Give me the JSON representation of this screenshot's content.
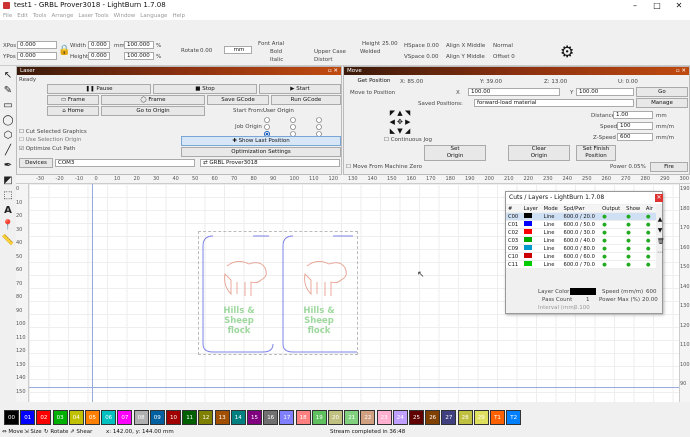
{
  "window": {
    "title": "test1 - GRBL Prover3018 - LightBurn 1.7.08"
  },
  "menu": [
    "File",
    "Edit",
    "Tools",
    "Arrange",
    "Laser Tools",
    "Window",
    "Language",
    "Help"
  ],
  "toolbar": {
    "icons": [
      "open-icon",
      "save-icon",
      "import-icon",
      "export-icon",
      "undo-icon",
      "redo-icon",
      "copy-icon",
      "paste-icon",
      "cut-icon",
      "delete-icon",
      "cursor-icon",
      "zoom-in-icon",
      "zoom-out-icon",
      "zoom-fit-icon",
      "pan-icon",
      "frame-icon",
      "camera-icon",
      "settings-icon",
      "wrench-icon",
      "monitor-icon",
      "window-icon",
      "clock-icon",
      "machine-icon",
      "gear-icon",
      "trace-icon"
    ]
  },
  "position": {
    "xpos_label": "XPos",
    "xpos": "0.000",
    "ypos_label": "YPos",
    "ypos": "0.000",
    "width_label": "Width",
    "width": "0.000",
    "height_label": "Height",
    "height": "0.000",
    "unit": "mm",
    "pct": "100.000",
    "pct_unit": "%",
    "rotate_label": "Rotate",
    "rotate": "0.00",
    "rot_unit": "mm"
  },
  "font": {
    "label": "Font",
    "value": "Arial",
    "height_label": "Height",
    "height": "25.00",
    "bold": "Bold",
    "italic": "Italic",
    "upper": "Upper Case",
    "welded": "Welded",
    "distort": "Distort",
    "hspace_label": "HSpace",
    "hspace": "0.00",
    "vspace_label": "VSpace",
    "vspace": "0.00",
    "alignx": "Align X Middle",
    "aligny": "Align Y Middle",
    "normal": "Normal",
    "offset_label": "Offset",
    "offset": "0"
  },
  "laser": {
    "title": "Laser",
    "status": "Ready",
    "pause": "Pause",
    "stop": "Stop",
    "start": "Start",
    "frame1": "Frame",
    "frame2": "Frame",
    "save_gcode": "Save GCode",
    "run_gcode": "Run GCode",
    "home": "Home",
    "goto_origin": "Go to Origin",
    "start_from_label": "Start From:",
    "start_from": "User Origin",
    "job_origin_label": "Job Origin",
    "cut_selected": "Cut Selected Graphics",
    "use_selection": "Use Selection Origin",
    "optimize": "Optimize Cut Path",
    "show_last": "Show Last Position",
    "opt_settings": "Optimization Settings",
    "devices": "Devices",
    "port": "COM3",
    "device": "GRBL Prover3018"
  },
  "move": {
    "title": "Move",
    "get_position": "Get Position",
    "x_label": "X:",
    "x": "85.00",
    "y_label": "Y:",
    "y": "39.00",
    "z_label": "Z:",
    "z": "13.00",
    "u_label": "U:",
    "u": "0.00",
    "move_to": "Move to Position",
    "mx_label": "X",
    "mx": "100.00",
    "my_label": "Y",
    "my": "100.00",
    "go": "Go",
    "saved_label": "Saved Positions:",
    "saved": "forward-load material",
    "manage": "Manage",
    "distance_label": "Distance",
    "distance": "1.00",
    "distance_unit": "mm",
    "speed_label": "Speed",
    "speed": "100",
    "speed_unit": "mm/m",
    "zspeed_label": "Z-Speed",
    "zspeed": "600",
    "zspeed_unit": "mm/m",
    "continuous": "Continuous Jog",
    "set_origin": "Set\nOrigin",
    "clear_origin": "Clear\nOrigin",
    "set_finish": "Set Finish\nPosition",
    "move_from_zero": "Move From Machine Zero",
    "power_label": "Power",
    "power": "0.05%",
    "fire": "Fire"
  },
  "ruler": {
    "top": [
      "-30",
      "-20",
      "-10",
      "0",
      "10",
      "20",
      "30",
      "40",
      "50",
      "60",
      "70",
      "80",
      "90",
      "100",
      "110",
      "120",
      "130",
      "140",
      "150",
      "160",
      "170",
      "180",
      "190",
      "200",
      "210",
      "220",
      "230",
      "240",
      "250",
      "260",
      "270",
      "280",
      "290",
      "300",
      "310"
    ],
    "left": [
      "0",
      "10",
      "20",
      "30",
      "40",
      "50",
      "60",
      "70",
      "80",
      "90",
      "100",
      "110",
      "120",
      "130",
      "140",
      "150",
      "160",
      "170",
      "180"
    ],
    "left_right": [
      "190",
      "180",
      "170",
      "160",
      "150",
      "140",
      "130",
      "120",
      "110",
      "100",
      "90"
    ],
    "bottom": "90"
  },
  "design": {
    "text1": "Hills & Sheep",
    "text1b": "flock",
    "text2": "Hills & Sheep",
    "text2b": "flock"
  },
  "cuts": {
    "title": "Cuts / Layers - LightBurn 1.7.08",
    "headers": [
      "#",
      "Layer",
      "Mode",
      "Spd/Pwr",
      "Output",
      "Show",
      "Air"
    ],
    "rows": [
      {
        "num": "C00",
        "color": "#000000",
        "mode": "Line",
        "spdpwr": "600.0 / 20.0"
      },
      {
        "num": "C01",
        "color": "#0000ff",
        "mode": "Line",
        "spdpwr": "600.0 / 50.0"
      },
      {
        "num": "C02",
        "color": "#ff0000",
        "mode": "Line",
        "spdpwr": "600.0 / 30.0"
      },
      {
        "num": "C03",
        "color": "#00aa00",
        "mode": "Line",
        "spdpwr": "600.0 / 40.0"
      },
      {
        "num": "C09",
        "color": "#0099cc",
        "mode": "Line",
        "spdpwr": "600.0 / 80.0"
      },
      {
        "num": "C10",
        "color": "#cc0000",
        "mode": "Line",
        "spdpwr": "600.0 / 60.0"
      },
      {
        "num": "C11",
        "color": "#00cc00",
        "mode": "Line",
        "spdpwr": "600.0 / 70.0"
      }
    ],
    "layer_color_label": "Layer Color",
    "speed_label": "Speed (mm/m)",
    "speed": "600",
    "pass_label": "Pass Count",
    "pass": "1",
    "power_max_label": "Power Max (%)",
    "power_max": "20.00",
    "interval_label": "Interval (mm)",
    "interval": "0.100"
  },
  "palette": [
    {
      "l": "00",
      "c": "#000000"
    },
    {
      "l": "01",
      "c": "#0000ff"
    },
    {
      "l": "02",
      "c": "#ff0000"
    },
    {
      "l": "03",
      "c": "#00b000"
    },
    {
      "l": "04",
      "c": "#c0c000"
    },
    {
      "l": "05",
      "c": "#ff8000"
    },
    {
      "l": "06",
      "c": "#00c0c0"
    },
    {
      "l": "07",
      "c": "#ff00ff"
    },
    {
      "l": "08",
      "c": "#b0b0b0"
    },
    {
      "l": "09",
      "c": "#0060a0"
    },
    {
      "l": "10",
      "c": "#a00000"
    },
    {
      "l": "11",
      "c": "#006000"
    },
    {
      "l": "12",
      "c": "#808000"
    },
    {
      "l": "13",
      "c": "#a05000"
    },
    {
      "l": "14",
      "c": "#008080"
    },
    {
      "l": "15",
      "c": "#800080"
    },
    {
      "l": "16",
      "c": "#707070"
    },
    {
      "l": "17",
      "c": "#8080ff"
    },
    {
      "l": "18",
      "c": "#ff8080"
    },
    {
      "l": "19",
      "c": "#60c060"
    },
    {
      "l": "20",
      "c": "#c0c080"
    },
    {
      "l": "21",
      "c": "#80d080"
    },
    {
      "l": "22",
      "c": "#d0a080"
    },
    {
      "l": "23",
      "c": "#ffb0d0"
    },
    {
      "l": "24",
      "c": "#c0a0ff"
    },
    {
      "l": "25",
      "c": "#600000"
    },
    {
      "l": "26",
      "c": "#804000"
    },
    {
      "l": "27",
      "c": "#404080"
    },
    {
      "l": "28",
      "c": "#c0c040"
    },
    {
      "l": "29",
      "c": "#e0e060"
    },
    {
      "l": "T1",
      "c": "#ff6000"
    },
    {
      "l": "T2",
      "c": "#0080ff"
    }
  ],
  "status": {
    "move": "Move",
    "size": "Size",
    "rotate": "Rotate",
    "shear": "Shear",
    "coords": "x: 142.00, y: 144.00 mm",
    "msg": "Stream completed in 36:48"
  }
}
